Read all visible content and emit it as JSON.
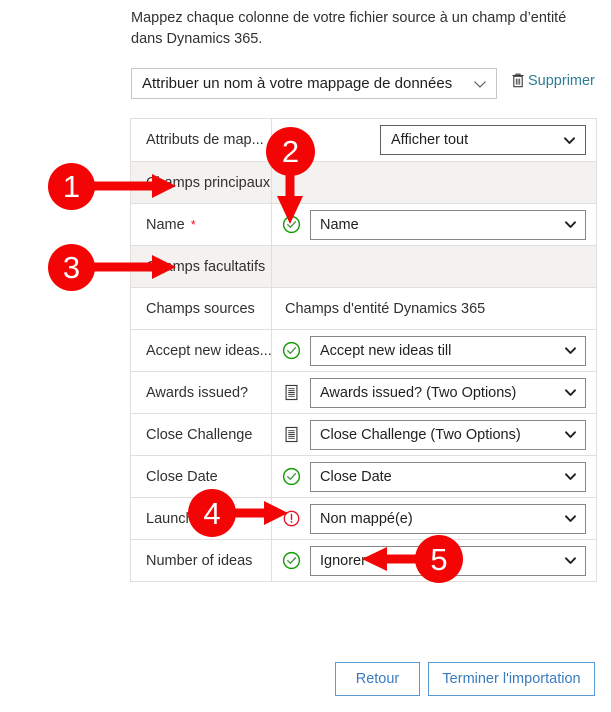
{
  "intro": {
    "text": "Mappez chaque colonne de votre fichier source à un champ d’entité dans Dynamics 365."
  },
  "mapping_name": {
    "value": "Attribuer un nom à votre mappage de données",
    "chevron_icon": "chevron-down-icon"
  },
  "delete": {
    "label": "Supprimer",
    "icon": "trash-icon"
  },
  "table": {
    "attributes_row": {
      "label": "Attributs de map...",
      "filter_value": "Afficher tout"
    },
    "group_primary": "Champs principaux",
    "group_optional": "Champs facultatifs",
    "primary_row": {
      "source": "Name",
      "required_marker": "*",
      "status_icon": "check-circle-icon",
      "target": "Name"
    },
    "headers": {
      "source": "Champs sources",
      "target": "Champs d'entité Dynamics 365"
    },
    "rows": [
      {
        "source": "Accept new ideas...",
        "status_icon": "check-circle-icon",
        "target": "Accept new ideas till"
      },
      {
        "source": "Awards issued?",
        "status_icon": "list-document-icon",
        "target": "Awards issued? (Two Options)"
      },
      {
        "source": "Close Challenge",
        "status_icon": "list-document-icon",
        "target": "Close Challenge (Two Options)"
      },
      {
        "source": "Close Date",
        "status_icon": "check-circle-icon",
        "target": "Close Date"
      },
      {
        "source": "Launch",
        "status_icon": "warning-circle-icon",
        "target": "Non mappé(e)"
      },
      {
        "source": "Number of ideas",
        "status_icon": "check-circle-icon",
        "target": "Ignorer"
      }
    ]
  },
  "footer": {
    "back_label": "Retour",
    "finish_label": "Terminer l'importation"
  },
  "callouts": [
    {
      "number": "1"
    },
    {
      "number": "2"
    },
    {
      "number": "3"
    },
    {
      "number": "4"
    },
    {
      "number": "5"
    }
  ],
  "colors": {
    "callout_red": "#f30505",
    "link_teal": "#2e7d92",
    "button_blue": "#3a7cbe",
    "status_ok_green": "#0f9d00",
    "status_warn_red": "#e81123",
    "required_red": "#e81123"
  }
}
